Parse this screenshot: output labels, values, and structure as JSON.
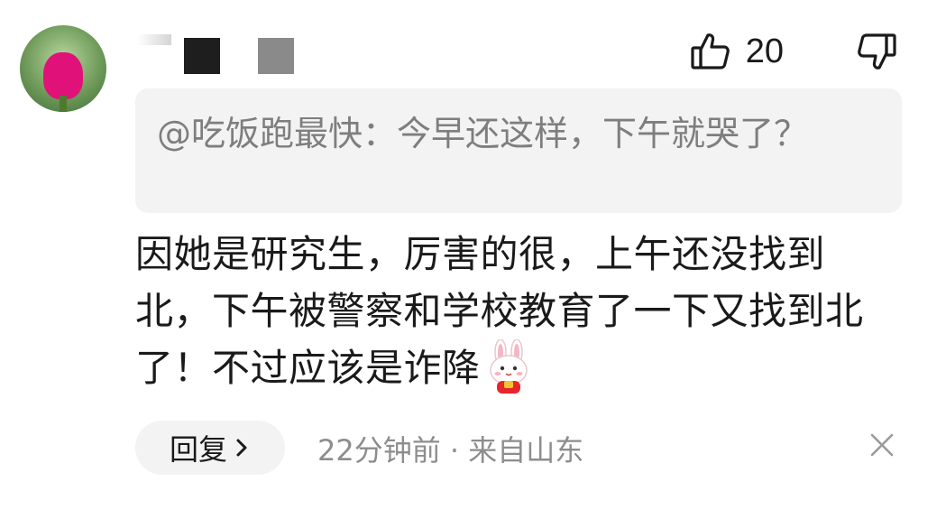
{
  "user": {
    "avatar_icon": "flower-avatar-icon"
  },
  "actions": {
    "like_icon": "thumbs-up-icon",
    "like_count": "20",
    "dislike_icon": "thumbs-down-icon"
  },
  "quote": {
    "text": "@吃饭跑最快：今早还这样，下午就哭了？"
  },
  "comment": {
    "text": "因她是研究生，厉害的很，上午还没找到北，下午被警察和学校教育了一下又找到北了！不过应该是诈降",
    "emoji_icon": "bunny-emoji-icon"
  },
  "footer": {
    "reply_label": "回复",
    "chevron_icon": "chevron-right-icon",
    "meta_text": "22分钟前 · 来自山东",
    "close_icon": "close-icon"
  },
  "colors": {
    "quote_bg": "#f3f3f3",
    "meta_text": "#8d8d8d",
    "quote_text": "#7e7e7e"
  }
}
